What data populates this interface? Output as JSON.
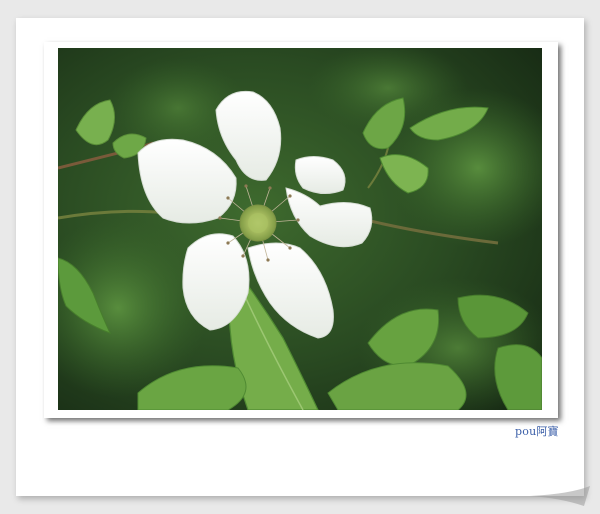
{
  "photo": {
    "subject": "white-bramble-flower-on-green-leaves",
    "colors": {
      "background_dark": "#1f3a1c",
      "leaf_light": "#6fae4a",
      "leaf_mid": "#4f8e35",
      "petal": "#f8f9f7",
      "center": "#b8c86a"
    }
  },
  "watermark": {
    "text": "pou阿寶"
  }
}
